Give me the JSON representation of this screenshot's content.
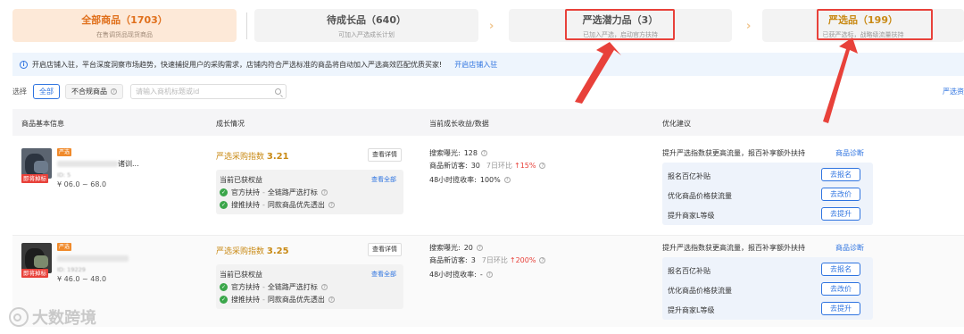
{
  "status_tabs": [
    {
      "title": "全部商品（1703）",
      "sub": "在售调货品现货商品"
    },
    {
      "title": "待成长品（640）",
      "sub": "可加入严选成长计划"
    },
    {
      "title": "严选潜力品（3）",
      "sub": "已加入严选，启动官方扶持"
    },
    {
      "title": "严选品（199）",
      "sub": "已获严选标，战略级流量扶持"
    }
  ],
  "notice": {
    "text": "开启店铺入驻，平台深度洞察市场趋势，快速捕捉用户的采购需求，店铺内符合严选标准的商品将自动加入严选高效匹配优质买家!",
    "link": "开启店铺入驻"
  },
  "filter": {
    "label": "选择",
    "all": "全部",
    "noncompliant": "不合规商品",
    "search_placeholder": "请输入商机标题或id",
    "right_link": "严选资"
  },
  "table_headers": {
    "product": "商品基本信息",
    "growth": "成长情况",
    "earnings": "当前成长收益/数据",
    "advice": "优化建议"
  },
  "rows": [
    {
      "tag": "严选",
      "title_tail": "诸训...",
      "id_text": "ID: 5",
      "soon_tag": "即将掉标",
      "price": "¥ 06.0 ~ 68.0",
      "index_label": "严选采购指数",
      "index_value": "3.21",
      "detail_btn": "查看详情",
      "benefit_title": "当前已获权益",
      "benefit_all": "查看全部",
      "benefits": [
        "官方扶持",
        "全链路严选打标",
        "搜推扶持",
        "同款商品优先透出"
      ],
      "exposure_label": "搜索曝光:",
      "exposure": "128",
      "visitors_label": "商品新访客:",
      "visitors": "30",
      "visitors_cmp_label": "7日环比",
      "visitors_cmp": "15%",
      "reply_label": "48小时揽收率:",
      "reply": "100%",
      "advice_title": "提升严选指数获更高流量，报百补享额外扶持",
      "diag_link": "商品诊断",
      "advice_items": [
        "报名百亿补贴",
        "优化商品价格获流量",
        "提升商家L等级"
      ],
      "advice_btns": [
        "去报名",
        "去改价",
        "去提升"
      ]
    },
    {
      "tag": "严选",
      "title_tail": "",
      "id_text": "ID: 19229",
      "soon_tag": "即将掉标",
      "price": "¥ 46.0 ~ 48.0",
      "index_label": "严选采购指数",
      "index_value": "3.25",
      "detail_btn": "查看详情",
      "benefit_title": "当前已获权益",
      "benefit_all": "查看全部",
      "benefits": [
        "官方扶持",
        "全链路严选打标",
        "搜推扶持",
        "同款商品优先透出"
      ],
      "exposure_label": "搜索曝光:",
      "exposure": "20",
      "visitors_label": "商品新访客:",
      "visitors": "3",
      "visitors_cmp_label": "7日环比",
      "visitors_cmp": "200%",
      "reply_label": "48小时揽收率:",
      "reply": "-",
      "advice_title": "提升严选指数获更高流量，报百补享额外扶持",
      "diag_link": "商品诊断",
      "advice_items": [
        "报名百亿补贴",
        "优化商品价格获流量",
        "提升商家L等级"
      ],
      "advice_btns": [
        "去报名",
        "去改价",
        "去提升"
      ]
    }
  ],
  "watermark": "大数跨境",
  "colors": {
    "accent_blue": "#2f74e0",
    "orange": "#e0701c",
    "gold": "#c98a15",
    "annotation_red": "#e8413a"
  }
}
